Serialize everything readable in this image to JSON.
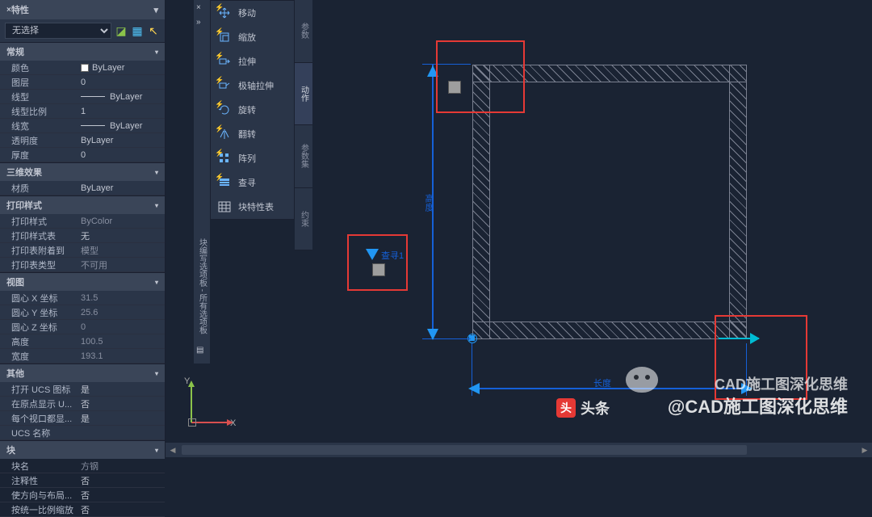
{
  "panel": {
    "title": "特性",
    "selection": "无选择",
    "sections": {
      "general": {
        "header": "常规",
        "color_label": "颜色",
        "color_value": "ByLayer",
        "layer_label": "图层",
        "layer_value": "0",
        "ltype_label": "线型",
        "ltype_value": "ByLayer",
        "ltscale_label": "线型比例",
        "ltscale_value": "1",
        "lweight_label": "线宽",
        "lweight_value": "ByLayer",
        "transp_label": "透明度",
        "transp_value": "ByLayer",
        "thick_label": "厚度",
        "thick_value": "0"
      },
      "effect3d": {
        "header": "三维效果",
        "material_label": "材质",
        "material_value": "ByLayer"
      },
      "plot": {
        "header": "打印样式",
        "pstyle_label": "打印样式",
        "pstyle_value": "ByColor",
        "ptable_label": "打印样式表",
        "ptable_value": "无",
        "pattach_label": "打印表附着到",
        "pattach_value": "模型",
        "ptype_label": "打印表类型",
        "ptype_value": "不可用"
      },
      "view": {
        "header": "视图",
        "cx_label": "圆心 X 坐标",
        "cx_value": "31.5",
        "cy_label": "圆心 Y 坐标",
        "cy_value": "25.6",
        "cz_label": "圆心 Z 坐标",
        "cz_value": "0",
        "h_label": "高度",
        "h_value": "100.5",
        "w_label": "宽度",
        "w_value": "193.1"
      },
      "misc": {
        "header": "其他",
        "ucs_label": "打开 UCS 图标",
        "ucs_value": "是",
        "origin_label": "在原点显示 U...",
        "origin_value": "否",
        "vp_label": "每个视口都显...",
        "vp_value": "是",
        "ucsname_label": "UCS 名称",
        "ucsname_value": ""
      },
      "block": {
        "header": "块",
        "bname_label": "块名",
        "bname_value": "方钢",
        "annot_label": "注释性",
        "annot_value": "否",
        "orient_label": "使方向与布局...",
        "orient_value": "否",
        "unif_label": "按统一比例缩放",
        "unif_value": "否"
      }
    }
  },
  "vert_strip_label": "块编写选项板 - 所有选项板",
  "actions": {
    "move": "移动",
    "scale": "缩放",
    "stretch": "拉伸",
    "polar": "极轴拉伸",
    "rotate": "旋转",
    "flip": "翻转",
    "array": "阵列",
    "lookup": "查寻",
    "proptable": "块特性表"
  },
  "tabs": {
    "t1": "参数",
    "t2": "动作",
    "t3": "参数集",
    "t4": "约束"
  },
  "ucs": {
    "x": "X",
    "y": "Y"
  },
  "dims": {
    "v_label": "高度",
    "h_label": "长度"
  },
  "param_text": "查寻1",
  "watermark1": "CAD施工图深化思维",
  "watermark2": "@CAD施工图深化思维",
  "toutiao": {
    "badge": "头",
    "text": "头条"
  }
}
